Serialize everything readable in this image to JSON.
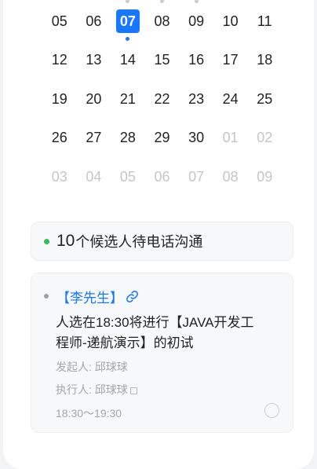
{
  "calendar": {
    "rows": [
      [
        {
          "d": "05",
          "o": false
        },
        {
          "d": "06",
          "o": false
        },
        {
          "d": "07",
          "o": false,
          "sel": true
        },
        {
          "d": "08",
          "o": false
        },
        {
          "d": "09",
          "o": false
        },
        {
          "d": "10",
          "o": false
        },
        {
          "d": "11",
          "o": false
        }
      ],
      [
        {
          "d": "12",
          "o": false
        },
        {
          "d": "13",
          "o": false
        },
        {
          "d": "14",
          "o": false
        },
        {
          "d": "15",
          "o": false
        },
        {
          "d": "16",
          "o": false
        },
        {
          "d": "17",
          "o": false
        },
        {
          "d": "18",
          "o": false
        }
      ],
      [
        {
          "d": "19",
          "o": false
        },
        {
          "d": "20",
          "o": false
        },
        {
          "d": "21",
          "o": false
        },
        {
          "d": "22",
          "o": false
        },
        {
          "d": "23",
          "o": false
        },
        {
          "d": "24",
          "o": false
        },
        {
          "d": "25",
          "o": false
        }
      ],
      [
        {
          "d": "26",
          "o": false
        },
        {
          "d": "27",
          "o": false
        },
        {
          "d": "28",
          "o": false
        },
        {
          "d": "29",
          "o": false
        },
        {
          "d": "30",
          "o": false
        },
        {
          "d": "01",
          "o": true
        },
        {
          "d": "02",
          "o": true
        }
      ],
      [
        {
          "d": "03",
          "o": true
        },
        {
          "d": "04",
          "o": true
        },
        {
          "d": "05",
          "o": true
        },
        {
          "d": "06",
          "o": true
        },
        {
          "d": "07",
          "o": true
        },
        {
          "d": "08",
          "o": true
        },
        {
          "d": "09",
          "o": true
        }
      ]
    ]
  },
  "summary": {
    "count": "10",
    "text": "个候选人待电话沟通"
  },
  "card": {
    "name": "【李先生】",
    "title": "人选在18:30将进行【JAVA开发工程师-递航演示】的初试",
    "initiator": "发起人: 邱球球",
    "executor": "执行人: 邱球球",
    "time": "18:30～19:30"
  },
  "colors": {
    "accent": "#1677ff",
    "green": "#2fbf5b"
  }
}
